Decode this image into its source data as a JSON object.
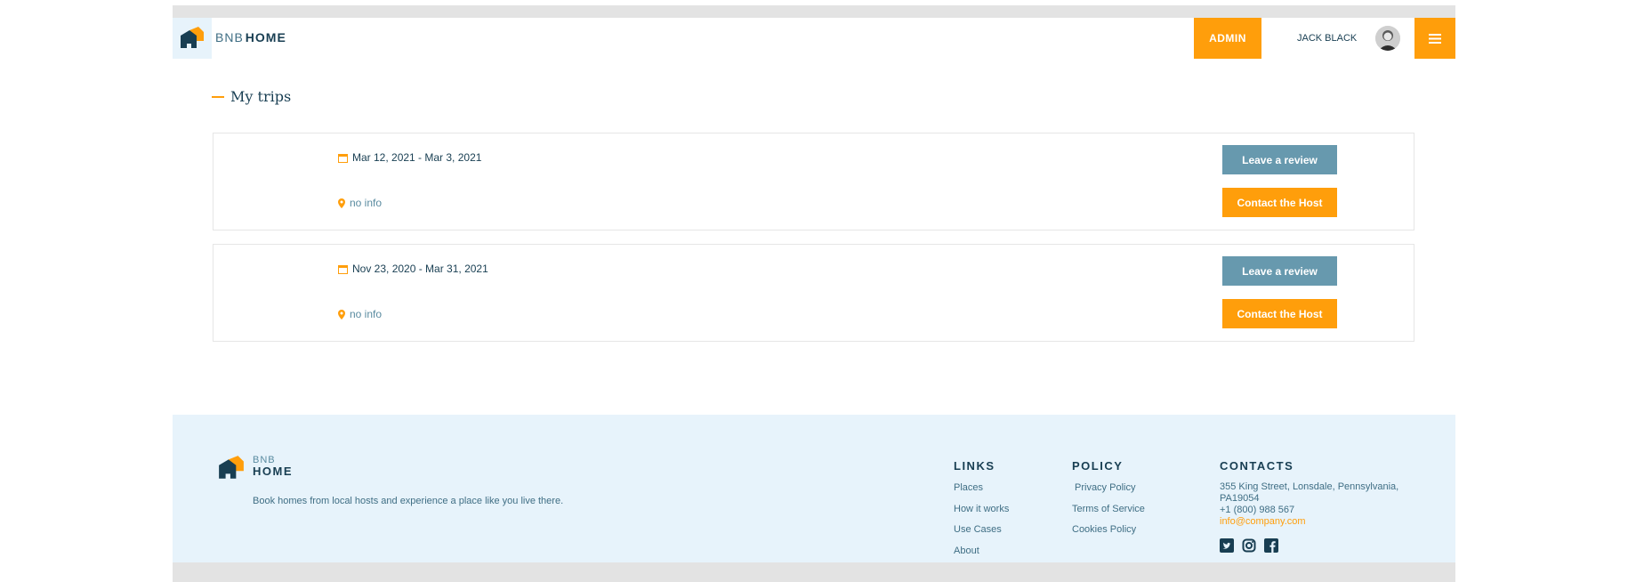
{
  "header": {
    "brand_light": "BNB",
    "brand_bold": "HOME",
    "admin_label": "ADMIN",
    "username": "JACK BLACK",
    "icons": [
      "house-logo-icon",
      "avatar",
      "hamburger-menu-icon"
    ]
  },
  "page": {
    "title": "My trips"
  },
  "trips": [
    {
      "dates": "Mar 12, 2021 - Mar 3, 2021",
      "location": "no info",
      "review_label": "Leave a review",
      "contact_label": "Contact the Host"
    },
    {
      "dates": "Nov 23, 2020 - Mar 31, 2021",
      "location": "no info",
      "review_label": "Leave a review",
      "contact_label": "Contact the Host"
    }
  ],
  "footer": {
    "brand_light": "BNB",
    "brand_bold": "HOME",
    "tagline": "Book homes from local hosts and experience a place like you live there.",
    "links": {
      "title": "LINKS",
      "items": [
        "Places",
        "How it works",
        "Use Cases",
        "About"
      ]
    },
    "policy": {
      "title": "POLICY",
      "items": [
        "Privacy Policy",
        "Terms of Service",
        "Cookies Policy"
      ]
    },
    "contacts": {
      "title": "CONTACTS",
      "address_line1": "355 King Street, Lonsdale, Pennsylvania,",
      "address_line2": "PA19054",
      "phone": "+1 (800) 988 567",
      "email": "info@company.com"
    },
    "social": [
      "twitter-icon",
      "instagram-icon",
      "facebook-icon"
    ]
  },
  "colors": {
    "accent": "#ff9e0b",
    "primary_dark": "#183e52",
    "secondary": "#6799ae",
    "footer_bg": "#e7f3fb"
  }
}
